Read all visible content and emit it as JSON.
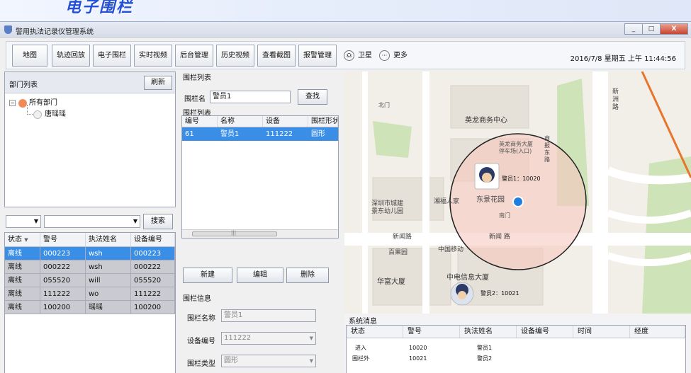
{
  "banner": {
    "title": "电子围栏"
  },
  "window": {
    "title": "警用执法记录仪管理系统",
    "min": "_",
    "max": "□",
    "close": "X"
  },
  "toolbar": {
    "buttons": [
      "地图",
      "轨迹回放",
      "电子围栏",
      "实时视频",
      "后台管理",
      "历史视频",
      "查看截图",
      "报警管理"
    ],
    "satellite": "卫星",
    "more": "更多",
    "datetime": "2016/7/8 星期五 上午 11:44:56"
  },
  "dept": {
    "title": "部门列表",
    "refresh": "刷新",
    "root": "所有部门",
    "child": "唐瑶瑶"
  },
  "search": {
    "button": "搜索"
  },
  "users": {
    "headers": [
      "状态",
      "警号",
      "执法姓名",
      "设备编号"
    ],
    "rows": [
      [
        "离线",
        "000223",
        "wsh",
        "000223"
      ],
      [
        "离线",
        "000222",
        "wsh",
        "000222"
      ],
      [
        "离线",
        "055520",
        "will",
        "055520"
      ],
      [
        "离线",
        "111222",
        "wo",
        "111222"
      ],
      [
        "离线",
        "100200",
        "瑶瑶",
        "100200"
      ]
    ]
  },
  "fences": {
    "section": "围栏列表",
    "name_label": "围栏名",
    "name_value": "警员1",
    "find": "查找",
    "list_label": "围栏列表",
    "headers": [
      "编号",
      "名称",
      "设备",
      "围栏形状"
    ],
    "rows": [
      [
        "61",
        "警员1",
        "111222",
        "圆形"
      ]
    ],
    "scroll_label": "|||",
    "new": "新建",
    "edit": "编辑",
    "delete": "删除"
  },
  "info": {
    "section": "围栏信息",
    "name_label": "围栏名称",
    "name_value": "警员1",
    "device_label": "设备编号",
    "device_value": "111222",
    "type_label": "围栏类型",
    "type_value": "圆形"
  },
  "map": {
    "labels": {
      "commercial": "英龙商务中心",
      "parking": "英龙商务大厦\n停车场(入口)",
      "south_gate1": "南门",
      "south_gate2": "南门",
      "donggarden": "东景花园",
      "xiangfu": "湘福人家",
      "kindergarten": "深圳市城建\n景东幼儿园",
      "xinwen_road": "新闻路",
      "xinwen_road2": "新闻 路",
      "baiguo": "百果园",
      "chinamobile": "中国移动",
      "huafu": "华富大厦",
      "zhongxin": "中电信息大厦",
      "xinzhou_road": "新\n洲\n路",
      "shangbao_road": "商\n报\n东\n路",
      "north_gate": "北门"
    },
    "officer1": "警员1：10020",
    "officer2": "警员2：10021"
  },
  "messages": {
    "title": "系统消息",
    "headers": [
      "状态",
      "警号",
      "执法姓名",
      "设备编号",
      "时间",
      "经度"
    ],
    "rows": [
      [
        "进入",
        "10020",
        "警员1"
      ],
      [
        "围栏外",
        "10021",
        "警员2"
      ]
    ]
  },
  "colors": {
    "accent": "#3a8ee6",
    "fence": "#f7c8c0",
    "close": "#c9442e"
  }
}
